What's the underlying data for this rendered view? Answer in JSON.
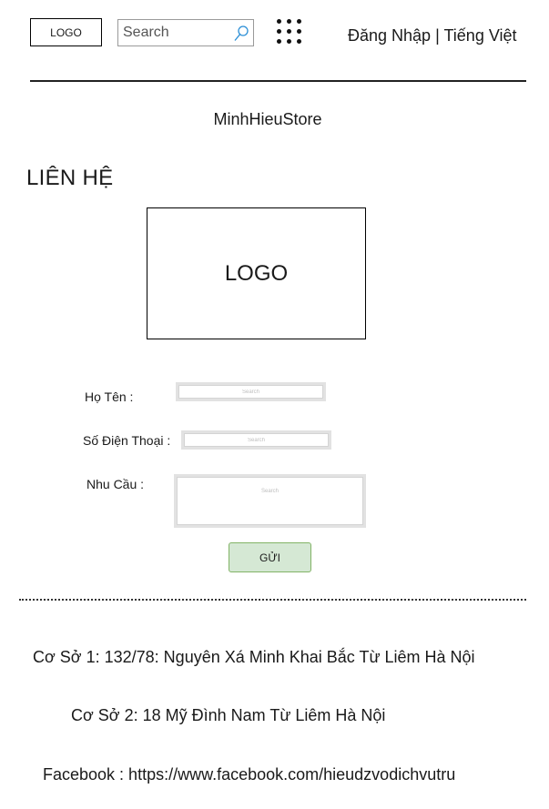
{
  "header": {
    "logo_text": "LOGO",
    "search_placeholder": "Search",
    "apps_icon": "grid-dots-icon",
    "login_label": "Đăng Nhập",
    "separator": "|",
    "language_label": "Tiếng Việt"
  },
  "store_name": "MinhHieuStore",
  "page_title": "LIÊN HỆ",
  "main_logo_text": "LOGO",
  "form": {
    "name_label": "Họ Tên :",
    "phone_label": "Số Điện Thoại :",
    "need_label": "Nhu Cầu :",
    "field_placeholder": "Search",
    "field_icon": "search-icon",
    "submit_label": "GỬI"
  },
  "footer": {
    "address1": "Cơ Sở 1: 132/78: Nguyên Xá Minh Khai Bắc Từ Liêm Hà Nội",
    "address2": "Cơ Sở 2: 18 Mỹ Đình Nam Từ Liêm Hà Nội",
    "facebook": "Facebook : https://www.facebook.com/hieudzvodichvutru"
  },
  "colors": {
    "button_fill": "#d5e8d4",
    "button_border": "#82b366",
    "field_border": "#e2e2e2"
  }
}
